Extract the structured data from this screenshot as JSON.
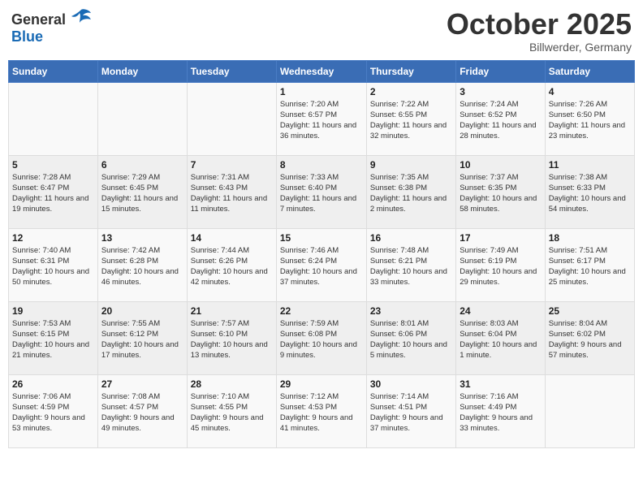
{
  "header": {
    "logo": {
      "text_general": "General",
      "text_blue": "Blue"
    },
    "month_title": "October 2025",
    "subtitle": "Billwerder, Germany"
  },
  "weekdays": [
    "Sunday",
    "Monday",
    "Tuesday",
    "Wednesday",
    "Thursday",
    "Friday",
    "Saturday"
  ],
  "weeks": [
    [
      {
        "day": "",
        "sunrise": "",
        "sunset": "",
        "daylight": ""
      },
      {
        "day": "",
        "sunrise": "",
        "sunset": "",
        "daylight": ""
      },
      {
        "day": "",
        "sunrise": "",
        "sunset": "",
        "daylight": ""
      },
      {
        "day": "1",
        "sunrise": "Sunrise: 7:20 AM",
        "sunset": "Sunset: 6:57 PM",
        "daylight": "Daylight: 11 hours and 36 minutes."
      },
      {
        "day": "2",
        "sunrise": "Sunrise: 7:22 AM",
        "sunset": "Sunset: 6:55 PM",
        "daylight": "Daylight: 11 hours and 32 minutes."
      },
      {
        "day": "3",
        "sunrise": "Sunrise: 7:24 AM",
        "sunset": "Sunset: 6:52 PM",
        "daylight": "Daylight: 11 hours and 28 minutes."
      },
      {
        "day": "4",
        "sunrise": "Sunrise: 7:26 AM",
        "sunset": "Sunset: 6:50 PM",
        "daylight": "Daylight: 11 hours and 23 minutes."
      }
    ],
    [
      {
        "day": "5",
        "sunrise": "Sunrise: 7:28 AM",
        "sunset": "Sunset: 6:47 PM",
        "daylight": "Daylight: 11 hours and 19 minutes."
      },
      {
        "day": "6",
        "sunrise": "Sunrise: 7:29 AM",
        "sunset": "Sunset: 6:45 PM",
        "daylight": "Daylight: 11 hours and 15 minutes."
      },
      {
        "day": "7",
        "sunrise": "Sunrise: 7:31 AM",
        "sunset": "Sunset: 6:43 PM",
        "daylight": "Daylight: 11 hours and 11 minutes."
      },
      {
        "day": "8",
        "sunrise": "Sunrise: 7:33 AM",
        "sunset": "Sunset: 6:40 PM",
        "daylight": "Daylight: 11 hours and 7 minutes."
      },
      {
        "day": "9",
        "sunrise": "Sunrise: 7:35 AM",
        "sunset": "Sunset: 6:38 PM",
        "daylight": "Daylight: 11 hours and 2 minutes."
      },
      {
        "day": "10",
        "sunrise": "Sunrise: 7:37 AM",
        "sunset": "Sunset: 6:35 PM",
        "daylight": "Daylight: 10 hours and 58 minutes."
      },
      {
        "day": "11",
        "sunrise": "Sunrise: 7:38 AM",
        "sunset": "Sunset: 6:33 PM",
        "daylight": "Daylight: 10 hours and 54 minutes."
      }
    ],
    [
      {
        "day": "12",
        "sunrise": "Sunrise: 7:40 AM",
        "sunset": "Sunset: 6:31 PM",
        "daylight": "Daylight: 10 hours and 50 minutes."
      },
      {
        "day": "13",
        "sunrise": "Sunrise: 7:42 AM",
        "sunset": "Sunset: 6:28 PM",
        "daylight": "Daylight: 10 hours and 46 minutes."
      },
      {
        "day": "14",
        "sunrise": "Sunrise: 7:44 AM",
        "sunset": "Sunset: 6:26 PM",
        "daylight": "Daylight: 10 hours and 42 minutes."
      },
      {
        "day": "15",
        "sunrise": "Sunrise: 7:46 AM",
        "sunset": "Sunset: 6:24 PM",
        "daylight": "Daylight: 10 hours and 37 minutes."
      },
      {
        "day": "16",
        "sunrise": "Sunrise: 7:48 AM",
        "sunset": "Sunset: 6:21 PM",
        "daylight": "Daylight: 10 hours and 33 minutes."
      },
      {
        "day": "17",
        "sunrise": "Sunrise: 7:49 AM",
        "sunset": "Sunset: 6:19 PM",
        "daylight": "Daylight: 10 hours and 29 minutes."
      },
      {
        "day": "18",
        "sunrise": "Sunrise: 7:51 AM",
        "sunset": "Sunset: 6:17 PM",
        "daylight": "Daylight: 10 hours and 25 minutes."
      }
    ],
    [
      {
        "day": "19",
        "sunrise": "Sunrise: 7:53 AM",
        "sunset": "Sunset: 6:15 PM",
        "daylight": "Daylight: 10 hours and 21 minutes."
      },
      {
        "day": "20",
        "sunrise": "Sunrise: 7:55 AM",
        "sunset": "Sunset: 6:12 PM",
        "daylight": "Daylight: 10 hours and 17 minutes."
      },
      {
        "day": "21",
        "sunrise": "Sunrise: 7:57 AM",
        "sunset": "Sunset: 6:10 PM",
        "daylight": "Daylight: 10 hours and 13 minutes."
      },
      {
        "day": "22",
        "sunrise": "Sunrise: 7:59 AM",
        "sunset": "Sunset: 6:08 PM",
        "daylight": "Daylight: 10 hours and 9 minutes."
      },
      {
        "day": "23",
        "sunrise": "Sunrise: 8:01 AM",
        "sunset": "Sunset: 6:06 PM",
        "daylight": "Daylight: 10 hours and 5 minutes."
      },
      {
        "day": "24",
        "sunrise": "Sunrise: 8:03 AM",
        "sunset": "Sunset: 6:04 PM",
        "daylight": "Daylight: 10 hours and 1 minute."
      },
      {
        "day": "25",
        "sunrise": "Sunrise: 8:04 AM",
        "sunset": "Sunset: 6:02 PM",
        "daylight": "Daylight: 9 hours and 57 minutes."
      }
    ],
    [
      {
        "day": "26",
        "sunrise": "Sunrise: 7:06 AM",
        "sunset": "Sunset: 4:59 PM",
        "daylight": "Daylight: 9 hours and 53 minutes."
      },
      {
        "day": "27",
        "sunrise": "Sunrise: 7:08 AM",
        "sunset": "Sunset: 4:57 PM",
        "daylight": "Daylight: 9 hours and 49 minutes."
      },
      {
        "day": "28",
        "sunrise": "Sunrise: 7:10 AM",
        "sunset": "Sunset: 4:55 PM",
        "daylight": "Daylight: 9 hours and 45 minutes."
      },
      {
        "day": "29",
        "sunrise": "Sunrise: 7:12 AM",
        "sunset": "Sunset: 4:53 PM",
        "daylight": "Daylight: 9 hours and 41 minutes."
      },
      {
        "day": "30",
        "sunrise": "Sunrise: 7:14 AM",
        "sunset": "Sunset: 4:51 PM",
        "daylight": "Daylight: 9 hours and 37 minutes."
      },
      {
        "day": "31",
        "sunrise": "Sunrise: 7:16 AM",
        "sunset": "Sunset: 4:49 PM",
        "daylight": "Daylight: 9 hours and 33 minutes."
      },
      {
        "day": "",
        "sunrise": "",
        "sunset": "",
        "daylight": ""
      }
    ]
  ]
}
